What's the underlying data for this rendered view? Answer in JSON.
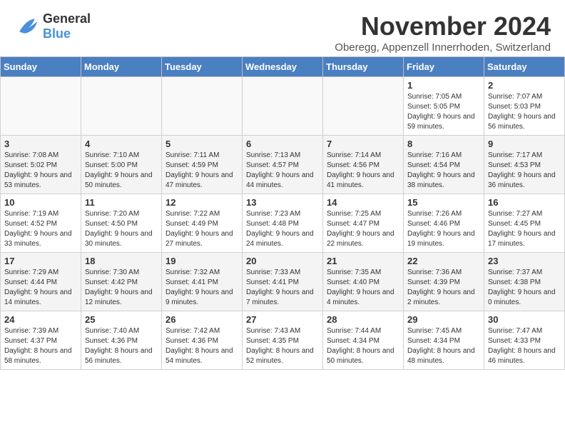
{
  "logo": {
    "general": "General",
    "blue": "Blue"
  },
  "title": "November 2024",
  "subtitle": "Oberegg, Appenzell Innerrhoden, Switzerland",
  "weekdays": [
    "Sunday",
    "Monday",
    "Tuesday",
    "Wednesday",
    "Thursday",
    "Friday",
    "Saturday"
  ],
  "weeks": [
    [
      {
        "day": "",
        "info": ""
      },
      {
        "day": "",
        "info": ""
      },
      {
        "day": "",
        "info": ""
      },
      {
        "day": "",
        "info": ""
      },
      {
        "day": "",
        "info": ""
      },
      {
        "day": "1",
        "info": "Sunrise: 7:05 AM\nSunset: 5:05 PM\nDaylight: 9 hours and 59 minutes."
      },
      {
        "day": "2",
        "info": "Sunrise: 7:07 AM\nSunset: 5:03 PM\nDaylight: 9 hours and 56 minutes."
      }
    ],
    [
      {
        "day": "3",
        "info": "Sunrise: 7:08 AM\nSunset: 5:02 PM\nDaylight: 9 hours and 53 minutes."
      },
      {
        "day": "4",
        "info": "Sunrise: 7:10 AM\nSunset: 5:00 PM\nDaylight: 9 hours and 50 minutes."
      },
      {
        "day": "5",
        "info": "Sunrise: 7:11 AM\nSunset: 4:59 PM\nDaylight: 9 hours and 47 minutes."
      },
      {
        "day": "6",
        "info": "Sunrise: 7:13 AM\nSunset: 4:57 PM\nDaylight: 9 hours and 44 minutes."
      },
      {
        "day": "7",
        "info": "Sunrise: 7:14 AM\nSunset: 4:56 PM\nDaylight: 9 hours and 41 minutes."
      },
      {
        "day": "8",
        "info": "Sunrise: 7:16 AM\nSunset: 4:54 PM\nDaylight: 9 hours and 38 minutes."
      },
      {
        "day": "9",
        "info": "Sunrise: 7:17 AM\nSunset: 4:53 PM\nDaylight: 9 hours and 36 minutes."
      }
    ],
    [
      {
        "day": "10",
        "info": "Sunrise: 7:19 AM\nSunset: 4:52 PM\nDaylight: 9 hours and 33 minutes."
      },
      {
        "day": "11",
        "info": "Sunrise: 7:20 AM\nSunset: 4:50 PM\nDaylight: 9 hours and 30 minutes."
      },
      {
        "day": "12",
        "info": "Sunrise: 7:22 AM\nSunset: 4:49 PM\nDaylight: 9 hours and 27 minutes."
      },
      {
        "day": "13",
        "info": "Sunrise: 7:23 AM\nSunset: 4:48 PM\nDaylight: 9 hours and 24 minutes."
      },
      {
        "day": "14",
        "info": "Sunrise: 7:25 AM\nSunset: 4:47 PM\nDaylight: 9 hours and 22 minutes."
      },
      {
        "day": "15",
        "info": "Sunrise: 7:26 AM\nSunset: 4:46 PM\nDaylight: 9 hours and 19 minutes."
      },
      {
        "day": "16",
        "info": "Sunrise: 7:27 AM\nSunset: 4:45 PM\nDaylight: 9 hours and 17 minutes."
      }
    ],
    [
      {
        "day": "17",
        "info": "Sunrise: 7:29 AM\nSunset: 4:44 PM\nDaylight: 9 hours and 14 minutes."
      },
      {
        "day": "18",
        "info": "Sunrise: 7:30 AM\nSunset: 4:42 PM\nDaylight: 9 hours and 12 minutes."
      },
      {
        "day": "19",
        "info": "Sunrise: 7:32 AM\nSunset: 4:41 PM\nDaylight: 9 hours and 9 minutes."
      },
      {
        "day": "20",
        "info": "Sunrise: 7:33 AM\nSunset: 4:41 PM\nDaylight: 9 hours and 7 minutes."
      },
      {
        "day": "21",
        "info": "Sunrise: 7:35 AM\nSunset: 4:40 PM\nDaylight: 9 hours and 4 minutes."
      },
      {
        "day": "22",
        "info": "Sunrise: 7:36 AM\nSunset: 4:39 PM\nDaylight: 9 hours and 2 minutes."
      },
      {
        "day": "23",
        "info": "Sunrise: 7:37 AM\nSunset: 4:38 PM\nDaylight: 9 hours and 0 minutes."
      }
    ],
    [
      {
        "day": "24",
        "info": "Sunrise: 7:39 AM\nSunset: 4:37 PM\nDaylight: 8 hours and 58 minutes."
      },
      {
        "day": "25",
        "info": "Sunrise: 7:40 AM\nSunset: 4:36 PM\nDaylight: 8 hours and 56 minutes."
      },
      {
        "day": "26",
        "info": "Sunrise: 7:42 AM\nSunset: 4:36 PM\nDaylight: 8 hours and 54 minutes."
      },
      {
        "day": "27",
        "info": "Sunrise: 7:43 AM\nSunset: 4:35 PM\nDaylight: 8 hours and 52 minutes."
      },
      {
        "day": "28",
        "info": "Sunrise: 7:44 AM\nSunset: 4:34 PM\nDaylight: 8 hours and 50 minutes."
      },
      {
        "day": "29",
        "info": "Sunrise: 7:45 AM\nSunset: 4:34 PM\nDaylight: 8 hours and 48 minutes."
      },
      {
        "day": "30",
        "info": "Sunrise: 7:47 AM\nSunset: 4:33 PM\nDaylight: 8 hours and 46 minutes."
      }
    ]
  ]
}
